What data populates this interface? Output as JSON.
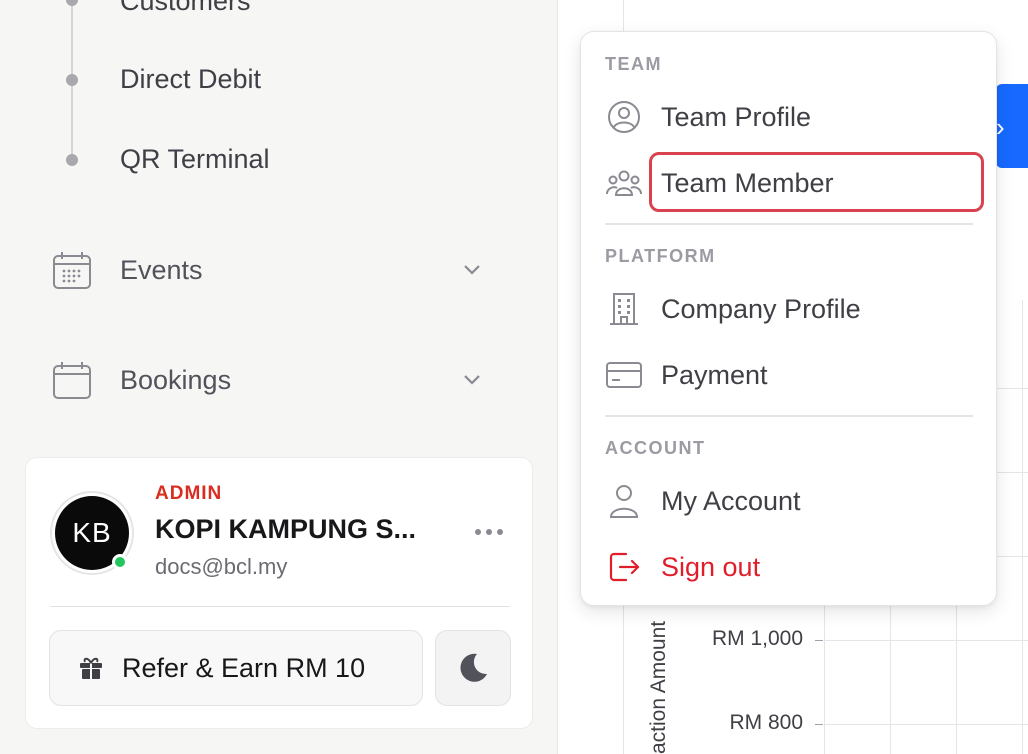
{
  "sidebar": {
    "sub_items": [
      "Customers",
      "Direct Debit",
      "QR Terminal"
    ],
    "nav": {
      "events_label": "Events",
      "bookings_label": "Bookings"
    },
    "user": {
      "initials": "KB",
      "role": "ADMIN",
      "company": "KOPI KAMPUNG S...",
      "email": "docs@bcl.my",
      "status": "online"
    },
    "refer_label": "Refer & Earn RM 10"
  },
  "menu": {
    "team_title": "TEAM",
    "team_profile": "Team Profile",
    "team_member": "Team Member",
    "platform_title": "PLATFORM",
    "company_profile": "Company Profile",
    "payment": "Payment",
    "account_title": "ACCOUNT",
    "my_account": "My Account",
    "sign_out": "Sign out"
  },
  "main": {
    "y_axis_label": "action Amount",
    "ticks": [
      "RM 1,000",
      "RM 800"
    ]
  },
  "colors": {
    "accent_blue": "#1769ff",
    "danger": "#e11d2a",
    "admin": "#d92d20",
    "highlight": "#d9434f",
    "online": "#22c55e"
  }
}
